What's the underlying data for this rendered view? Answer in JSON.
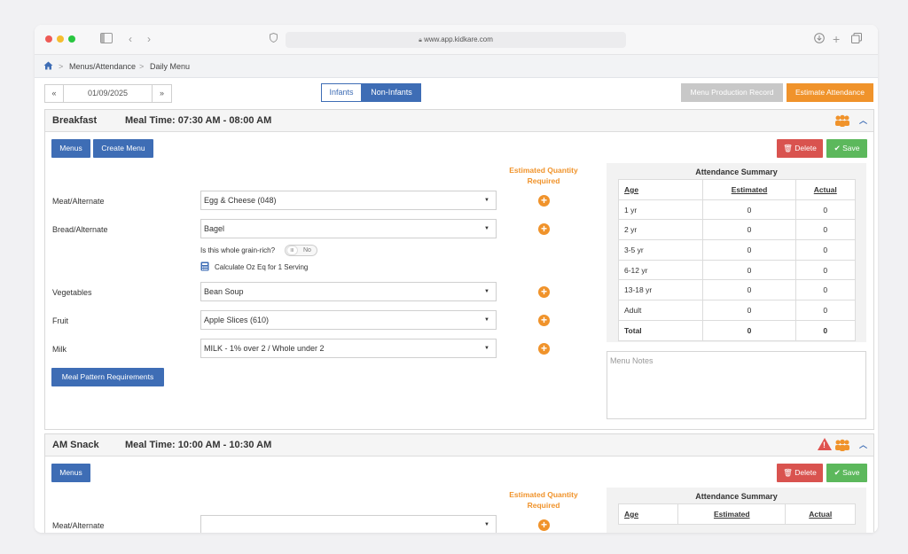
{
  "browser": {
    "url": "www.app.kidkare.com"
  },
  "breadcrumb": {
    "home_icon": "home-icon",
    "items": [
      "Menus/Attendance",
      "Daily Menu"
    ],
    "separator": ">"
  },
  "toolbar": {
    "prev_label": "«",
    "date_value": "01/09/2025",
    "next_label": "»",
    "infants_label": "Infants",
    "non_infants_label": "Non-Infants",
    "menu_production_label": "Menu Production Record",
    "estimate_attendance_label": "Estimate Attendance"
  },
  "colors": {
    "primary": "#3e6db5",
    "accent": "#f0932b",
    "danger": "#d9534f",
    "success": "#5cb85c"
  },
  "breakfast": {
    "title": "Breakfast",
    "meal_time": "Meal Time: 07:30 AM - 08:00 AM",
    "menus_label": "Menus",
    "create_menu_label": "Create Menu",
    "delete_label": "Delete",
    "save_label": "Save",
    "est_qty_label": "Estimated Quantity Required",
    "components": [
      {
        "label": "Meat/Alternate",
        "value": "Egg & Cheese (048)"
      },
      {
        "label": "Bread/Alternate",
        "value": "Bagel"
      },
      {
        "label": "Vegetables",
        "value": "Bean Soup"
      },
      {
        "label": "Fruit",
        "value": "Apple Slices (610)"
      },
      {
        "label": "Milk",
        "value": "MILK - 1% over 2 / Whole under 2"
      }
    ],
    "grain_question": "Is this whole grain-rich?",
    "grain_toggle": "No",
    "grain_toggle_bars": "III",
    "calc_label": "Calculate Oz Eq for 1 Serving",
    "meal_pattern_label": "Meal Pattern Requirements",
    "attendance": {
      "title": "Attendance Summary",
      "headers": [
        "Age",
        "Estimated",
        "Actual"
      ],
      "rows": [
        [
          "1 yr",
          "0",
          "0"
        ],
        [
          "2 yr",
          "0",
          "0"
        ],
        [
          "3-5 yr",
          "0",
          "0"
        ],
        [
          "6-12 yr",
          "0",
          "0"
        ],
        [
          "13-18 yr",
          "0",
          "0"
        ],
        [
          "Adult",
          "0",
          "0"
        ],
        [
          "Total",
          "0",
          "0"
        ]
      ]
    },
    "notes_placeholder": "Menu Notes"
  },
  "am_snack": {
    "title": "AM Snack",
    "meal_time": "Meal Time: 10:00 AM - 10:30 AM",
    "menus_label": "Menus",
    "delete_label": "Delete",
    "save_label": "Save",
    "est_qty_label": "Estimated Quantity Required",
    "components": [
      {
        "label": "Meat/Alternate",
        "value": ""
      }
    ],
    "attendance": {
      "title": "Attendance Summary",
      "headers": [
        "Age",
        "Estimated",
        "Actual"
      ]
    }
  }
}
